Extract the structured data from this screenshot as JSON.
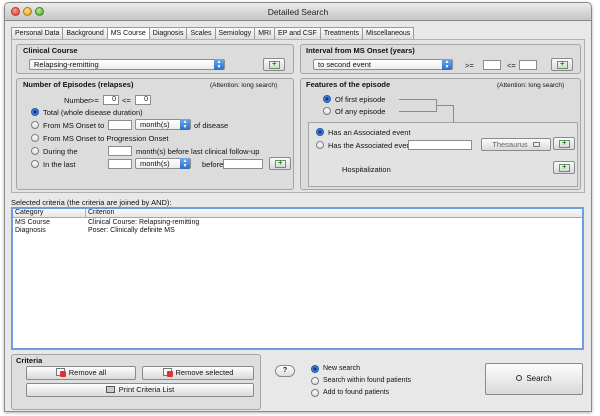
{
  "window": {
    "title": "Detailed Search"
  },
  "tabs": [
    "Personal Data",
    "Background",
    "MS Course",
    "Diagnosis",
    "Scales",
    "Semiology",
    "MRI",
    "EP and CSF",
    "Treatments",
    "Miscellaneous"
  ],
  "active_tab": "MS Course",
  "clinical_course": {
    "title": "Clinical Course",
    "selected": "Relapsing-remitting"
  },
  "interval": {
    "title": "Interval from MS Onset (years)",
    "selected": "to second event",
    "gte_label": ">=",
    "lte_label": "<="
  },
  "episodes": {
    "title": "Number of Episodes (relapses)",
    "attention": "(Attention: long search)",
    "number_label": "Number",
    "gte_label": ">=",
    "lte_label": "<=",
    "min_value": "0",
    "max_value": "0",
    "options": {
      "total": "Total (whole disease duration)",
      "from_onset": "From MS Onset to",
      "from_onset_suffix": "of disease",
      "to_progression": "From MS Onset to Progression Onset",
      "during_the": "During the",
      "during_suffix": "month(s) before last clinical follow-up",
      "in_the_last": "In the last",
      "before_label": "before"
    },
    "unit_selected": "month(s)"
  },
  "features": {
    "title": "Features of the episode",
    "attention": "(Attention: long search)",
    "first_episode": "Of first episode",
    "any_episode": "Of any episode",
    "associated": "Has an Associated event",
    "has_the_associated": "Has the Associated event",
    "thesaurus": "Thesaurus",
    "hospitalization": "Hospitalization"
  },
  "selected_criteria": {
    "label": "Selected criteria (the criteria are joined by AND):",
    "columns": [
      "Category",
      "Criterion"
    ],
    "rows": [
      {
        "category": "MS Course",
        "criterion": "Clinical Course: Relapsing-remitting"
      },
      {
        "category": "Diagnosis",
        "criterion": "Poser: Clinically definite MS"
      }
    ]
  },
  "criteria": {
    "title": "Criteria",
    "remove_all": "Remove all",
    "remove_selected": "Remove selected",
    "print": "Print Criteria List"
  },
  "search_mode": {
    "help": "?",
    "options": [
      "New search",
      "Search within found patients",
      "Add to found patients"
    ],
    "selected_index": 0
  },
  "search_button": "Search",
  "colors": {
    "accent": "#2a6ccb",
    "selection_border": "#6d9ce0"
  }
}
